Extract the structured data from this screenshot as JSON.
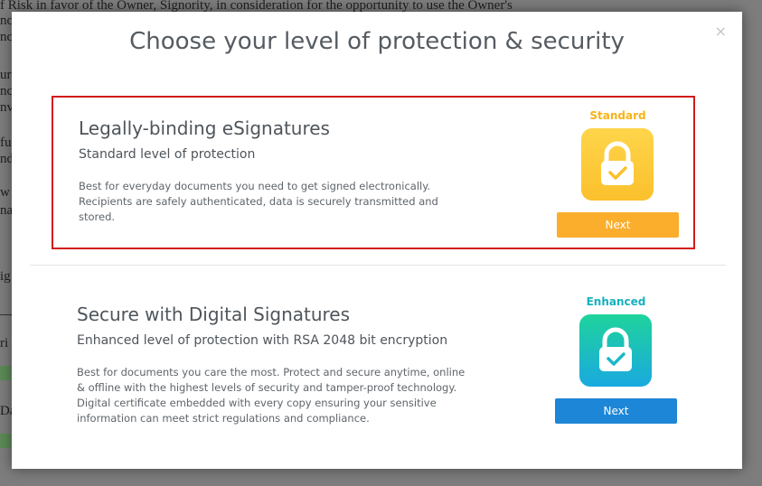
{
  "background_document": {
    "lines": [
      "f Risk in favor of the Owner, Signority, in consideration for the opportunity to use the Owner's",
      "ncl",
      "nci",
      "ur",
      "nci",
      "nv",
      "fu",
      "nd",
      "w",
      "na",
      "ig",
      "ri",
      "Da"
    ]
  },
  "modal": {
    "title": "Choose your level of protection & security",
    "close_glyph": "×",
    "options": [
      {
        "heading": "Legally-binding eSignatures",
        "subheading": "Standard level of protection",
        "description": "Best for everyday documents you need to get signed electronically. Recipients are safely authenticated, data is securely transmitted and stored.",
        "badge_label": "Standard",
        "badge_color": "#f7b318",
        "tile_gradient": [
          "#ffd54a",
          "#fbc02d"
        ],
        "icon": "lock-check-icon",
        "button_label": "Next",
        "button_color": "#fbae2c",
        "selected": true
      },
      {
        "heading": "Secure with Digital Signatures",
        "subheading": "Enhanced level of protection with RSA 2048 bit encryption",
        "description": "Best for documents you care the most. Protect and secure anytime, online & offline with the highest levels of security and tamper-proof technology. Digital certificate embedded with every copy ensuring your sensitive information can meet strict regulations and compliance.",
        "badge_label": "Enhanced",
        "badge_color": "#15b1c0",
        "tile_gradient": [
          "#1fd39c",
          "#1aa9e0"
        ],
        "icon": "lock-check-icon",
        "button_label": "Next",
        "button_color": "#1e86d6",
        "selected": false
      }
    ]
  }
}
